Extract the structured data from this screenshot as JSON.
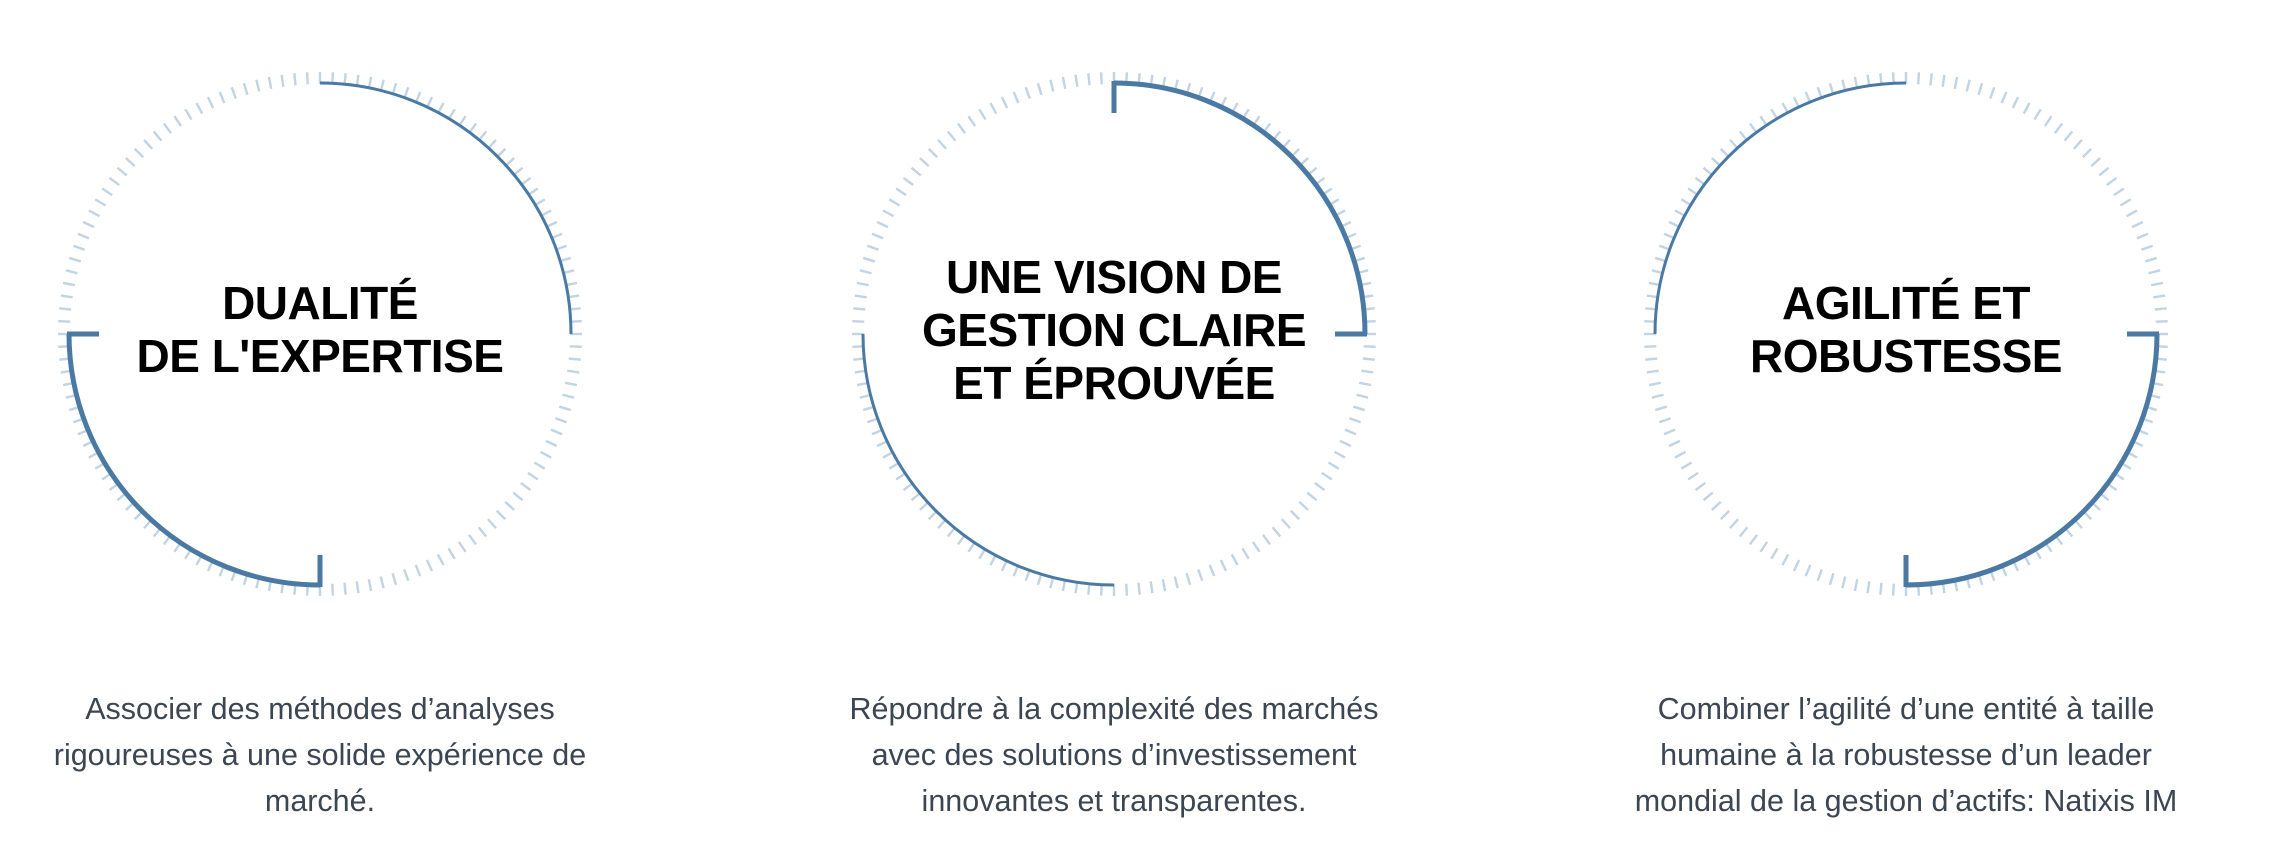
{
  "colors": {
    "arc": "#4a7aa4",
    "ticks": "#c2d3e2",
    "title": "#000000",
    "description": "#3b4652"
  },
  "cards": [
    {
      "title": "DUALITÉ\nDE L'EXPERTISE",
      "description": "Associer des méthodes d’analyses\nrigoureuses à une solide expérience de\nmarché.",
      "arcs": [
        {
          "from": 0,
          "to": 90,
          "weight": "thin"
        },
        {
          "from": 180,
          "to": 270,
          "weight": "thick"
        }
      ]
    },
    {
      "title": "UNE VISION DE\nGESTION CLAIRE\nET ÉPROUVÉE",
      "description": "Répondre à la complexité des marchés\navec des solutions d’investissement\ninnovantes et transparentes.",
      "arcs": [
        {
          "from": 0,
          "to": 90,
          "weight": "thick"
        },
        {
          "from": 180,
          "to": 270,
          "weight": "thin"
        }
      ]
    },
    {
      "title": "AGILITÉ ET\nROBUSTESSE",
      "description": "Combiner l’agilité d’une entité à taille\nhumaine à la robustesse d’un leader\nmondial de la gestion d’actifs: Natixis IM",
      "arcs": [
        {
          "from": 270,
          "to": 360,
          "weight": "thin"
        },
        {
          "from": 90,
          "to": 180,
          "weight": "thick"
        }
      ]
    }
  ]
}
